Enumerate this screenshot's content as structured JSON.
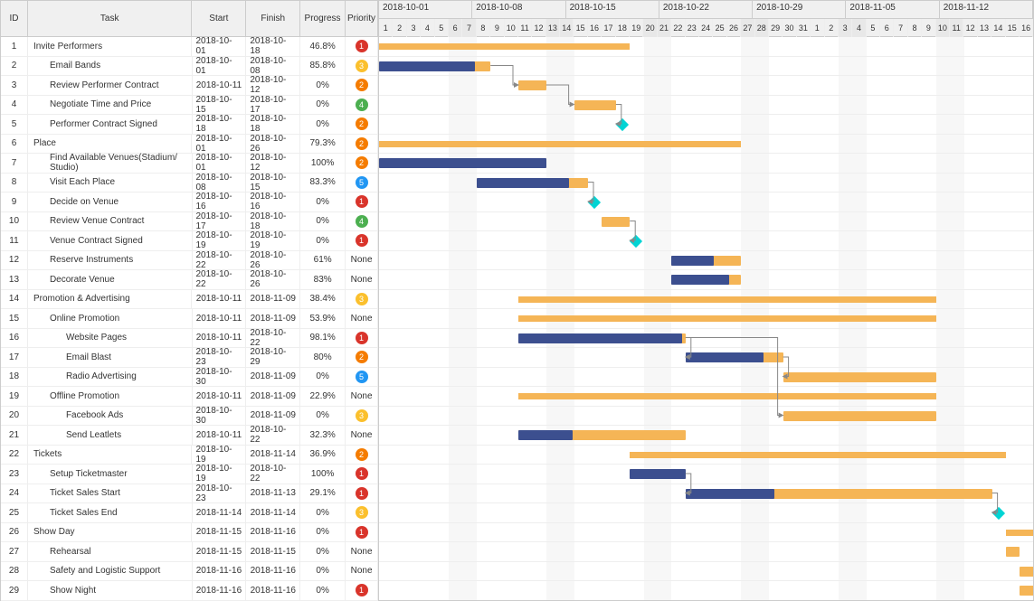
{
  "chart_data": {
    "type": "gantt",
    "date_range": [
      "2018-10-01",
      "2018-11-16"
    ],
    "weeks": [
      "2018-10-01",
      "2018-10-08",
      "2018-10-15",
      "2018-10-22",
      "2018-10-29",
      "2018-11-05",
      "2018-11-12"
    ],
    "days": [
      1,
      2,
      3,
      4,
      5,
      6,
      7,
      8,
      9,
      10,
      11,
      12,
      13,
      14,
      15,
      16,
      17,
      18,
      19,
      20,
      21,
      22,
      23,
      24,
      25,
      26,
      27,
      28,
      29,
      30,
      31,
      1,
      2,
      3,
      4,
      5,
      6,
      7,
      8,
      9,
      10,
      11,
      12,
      13,
      14,
      15,
      16
    ],
    "weekend_indices": [
      5,
      6,
      12,
      13,
      19,
      20,
      26,
      27,
      33,
      34,
      40,
      41
    ],
    "tasks": [
      {
        "id": 1,
        "name": "Invite Performers",
        "indent": 0,
        "start": "2018-10-01",
        "finish": "2018-10-18",
        "progress": "46.8%",
        "priority": 1,
        "type": "summary",
        "startIdx": 0,
        "endIdx": 18,
        "prog": 0.468
      },
      {
        "id": 2,
        "name": "Email Bands",
        "indent": 1,
        "start": "2018-10-01",
        "finish": "2018-10-08",
        "progress": "85.8%",
        "priority": 3,
        "type": "task",
        "startIdx": 0,
        "endIdx": 8,
        "prog": 0.858
      },
      {
        "id": 3,
        "name": "Review Performer Contract",
        "indent": 1,
        "start": "2018-10-11",
        "finish": "2018-10-12",
        "progress": "0%",
        "priority": 2,
        "type": "task",
        "startIdx": 10,
        "endIdx": 12,
        "prog": 0
      },
      {
        "id": 4,
        "name": "Negotiate Time and Price",
        "indent": 1,
        "start": "2018-10-15",
        "finish": "2018-10-17",
        "progress": "0%",
        "priority": 4,
        "type": "task",
        "startIdx": 14,
        "endIdx": 17,
        "prog": 0
      },
      {
        "id": 5,
        "name": "Performer Contract Signed",
        "indent": 1,
        "start": "2018-10-18",
        "finish": "2018-10-18",
        "progress": "0%",
        "priority": 2,
        "type": "milestone",
        "startIdx": 17,
        "endIdx": 17,
        "prog": 0
      },
      {
        "id": 6,
        "name": "Place",
        "indent": 0,
        "start": "2018-10-01",
        "finish": "2018-10-26",
        "progress": "79.3%",
        "priority": 2,
        "type": "summary",
        "startIdx": 0,
        "endIdx": 26,
        "prog": 0.793
      },
      {
        "id": 7,
        "name": "Find Available Venues(Stadium/ Studio)",
        "indent": 1,
        "start": "2018-10-01",
        "finish": "2018-10-12",
        "progress": "100%",
        "priority": 2,
        "type": "task",
        "startIdx": 0,
        "endIdx": 12,
        "prog": 1
      },
      {
        "id": 8,
        "name": "Visit Each Place",
        "indent": 1,
        "start": "2018-10-08",
        "finish": "2018-10-15",
        "progress": "83.3%",
        "priority": 5,
        "type": "task",
        "startIdx": 7,
        "endIdx": 15,
        "prog": 0.833
      },
      {
        "id": 9,
        "name": "Decide on Venue",
        "indent": 1,
        "start": "2018-10-16",
        "finish": "2018-10-16",
        "progress": "0%",
        "priority": 1,
        "type": "milestone",
        "startIdx": 15,
        "endIdx": 15,
        "prog": 0
      },
      {
        "id": 10,
        "name": "Review Venue Contract",
        "indent": 1,
        "start": "2018-10-17",
        "finish": "2018-10-18",
        "progress": "0%",
        "priority": 4,
        "type": "task",
        "startIdx": 16,
        "endIdx": 18,
        "prog": 0
      },
      {
        "id": 11,
        "name": "Venue Contract Signed",
        "indent": 1,
        "start": "2018-10-19",
        "finish": "2018-10-19",
        "progress": "0%",
        "priority": 1,
        "type": "milestone",
        "startIdx": 18,
        "endIdx": 18,
        "prog": 0
      },
      {
        "id": 12,
        "name": "Reserve Instruments",
        "indent": 1,
        "start": "2018-10-22",
        "finish": "2018-10-26",
        "progress": "61%",
        "priority": null,
        "type": "task",
        "startIdx": 21,
        "endIdx": 26,
        "prog": 0.61
      },
      {
        "id": 13,
        "name": "Decorate Venue",
        "indent": 1,
        "start": "2018-10-22",
        "finish": "2018-10-26",
        "progress": "83%",
        "priority": null,
        "type": "task",
        "startIdx": 21,
        "endIdx": 26,
        "prog": 0.83
      },
      {
        "id": 14,
        "name": "Promotion & Advertising",
        "indent": 0,
        "start": "2018-10-11",
        "finish": "2018-11-09",
        "progress": "38.4%",
        "priority": 3,
        "type": "summary",
        "startIdx": 10,
        "endIdx": 40,
        "prog": 0.384
      },
      {
        "id": 15,
        "name": "Online Promotion",
        "indent": 1,
        "start": "2018-10-11",
        "finish": "2018-11-09",
        "progress": "53.9%",
        "priority": null,
        "type": "summary",
        "startIdx": 10,
        "endIdx": 40,
        "prog": 0.539
      },
      {
        "id": 16,
        "name": "Website Pages",
        "indent": 2,
        "start": "2018-10-11",
        "finish": "2018-10-22",
        "progress": "98.1%",
        "priority": 1,
        "type": "task",
        "startIdx": 10,
        "endIdx": 22,
        "prog": 0.981
      },
      {
        "id": 17,
        "name": "Email Blast",
        "indent": 2,
        "start": "2018-10-23",
        "finish": "2018-10-29",
        "progress": "80%",
        "priority": 2,
        "type": "task",
        "startIdx": 22,
        "endIdx": 29,
        "prog": 0.8
      },
      {
        "id": 18,
        "name": "Radio Advertising",
        "indent": 2,
        "start": "2018-10-30",
        "finish": "2018-11-09",
        "progress": "0%",
        "priority": 5,
        "type": "task",
        "startIdx": 29,
        "endIdx": 40,
        "prog": 0
      },
      {
        "id": 19,
        "name": "Offline Promotion",
        "indent": 1,
        "start": "2018-10-11",
        "finish": "2018-11-09",
        "progress": "22.9%",
        "priority": null,
        "type": "summary",
        "startIdx": 10,
        "endIdx": 40,
        "prog": 0.229
      },
      {
        "id": 20,
        "name": "Facebook Ads",
        "indent": 2,
        "start": "2018-10-30",
        "finish": "2018-11-09",
        "progress": "0%",
        "priority": 3,
        "type": "task",
        "startIdx": 29,
        "endIdx": 40,
        "prog": 0
      },
      {
        "id": 21,
        "name": "Send Leatlets",
        "indent": 2,
        "start": "2018-10-11",
        "finish": "2018-10-22",
        "progress": "32.3%",
        "priority": null,
        "type": "task",
        "startIdx": 10,
        "endIdx": 22,
        "prog": 0.323
      },
      {
        "id": 22,
        "name": "Tickets",
        "indent": 0,
        "start": "2018-10-19",
        "finish": "2018-11-14",
        "progress": "36.9%",
        "priority": 2,
        "type": "summary",
        "startIdx": 18,
        "endIdx": 45,
        "prog": 0.369
      },
      {
        "id": 23,
        "name": "Setup Ticketmaster",
        "indent": 1,
        "start": "2018-10-19",
        "finish": "2018-10-22",
        "progress": "100%",
        "priority": 1,
        "type": "task",
        "startIdx": 18,
        "endIdx": 22,
        "prog": 1
      },
      {
        "id": 24,
        "name": "Ticket Sales Start",
        "indent": 1,
        "start": "2018-10-23",
        "finish": "2018-11-13",
        "progress": "29.1%",
        "priority": 1,
        "type": "task",
        "startIdx": 22,
        "endIdx": 44,
        "prog": 0.291
      },
      {
        "id": 25,
        "name": "Ticket Sales End",
        "indent": 1,
        "start": "2018-11-14",
        "finish": "2018-11-14",
        "progress": "0%",
        "priority": 3,
        "type": "milestone",
        "startIdx": 44,
        "endIdx": 44,
        "prog": 0
      },
      {
        "id": 26,
        "name": "Show Day",
        "indent": 0,
        "start": "2018-11-15",
        "finish": "2018-11-16",
        "progress": "0%",
        "priority": 1,
        "type": "summary",
        "startIdx": 45,
        "endIdx": 47,
        "prog": 0
      },
      {
        "id": 27,
        "name": "Rehearsal",
        "indent": 1,
        "start": "2018-11-15",
        "finish": "2018-11-15",
        "progress": "0%",
        "priority": null,
        "type": "task",
        "startIdx": 45,
        "endIdx": 46,
        "prog": 0
      },
      {
        "id": 28,
        "name": "Safety and Logistic Support",
        "indent": 1,
        "start": "2018-11-16",
        "finish": "2018-11-16",
        "progress": "0%",
        "priority": null,
        "type": "task",
        "startIdx": 46,
        "endIdx": 47,
        "prog": 0
      },
      {
        "id": 29,
        "name": "Show Night",
        "indent": 1,
        "start": "2018-11-16",
        "finish": "2018-11-16",
        "progress": "0%",
        "priority": 1,
        "type": "task",
        "startIdx": 46,
        "endIdx": 47,
        "prog": 0
      }
    ],
    "dependencies": [
      {
        "from": 2,
        "to": 3
      },
      {
        "from": 3,
        "to": 4
      },
      {
        "from": 4,
        "to": 5
      },
      {
        "from": 8,
        "to": 9
      },
      {
        "from": 10,
        "to": 11
      },
      {
        "from": 16,
        "to": 17
      },
      {
        "from": 16,
        "to": 20
      },
      {
        "from": 17,
        "to": 18
      },
      {
        "from": 23,
        "to": 24
      },
      {
        "from": 24,
        "to": 25
      }
    ]
  },
  "headers": {
    "id": "ID",
    "task": "Task",
    "start": "Start",
    "finish": "Finish",
    "progress": "Progress",
    "priority": "Priority"
  },
  "none_label": "None"
}
